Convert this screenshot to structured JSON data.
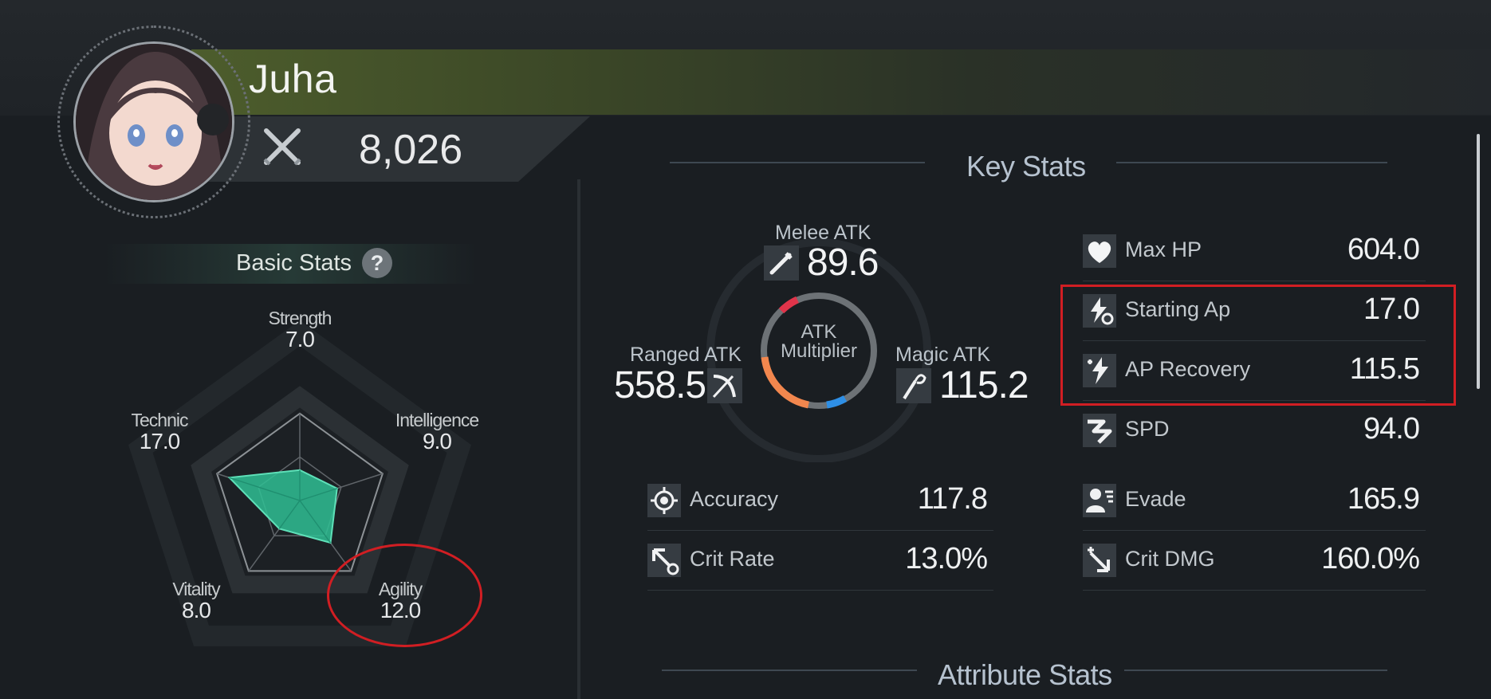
{
  "character": {
    "name": "Juha",
    "power": "8,026",
    "power_icon": "crossed-swords-icon"
  },
  "basic_stats": {
    "title": "Basic Stats",
    "help_icon": "?",
    "radar": [
      {
        "label": "Strength",
        "value": "7.0",
        "level": 7.0
      },
      {
        "label": "Intelligence",
        "value": "9.0",
        "level": 9.0
      },
      {
        "label": "Agility",
        "value": "12.0",
        "level": 12.0
      },
      {
        "label": "Vitality",
        "value": "8.0",
        "level": 8.0
      },
      {
        "label": "Technic",
        "value": "17.0",
        "level": 17.0
      }
    ],
    "radar_max": 20,
    "fill_color": "#2fbf94",
    "highlighted_stat": "Agility"
  },
  "key_stats": {
    "title": "Key Stats",
    "melee": {
      "label": "Melee ATK",
      "value": "89.6"
    },
    "ranged": {
      "label": "Ranged ATK",
      "value": "558.5"
    },
    "magic": {
      "label": "Magic ATK",
      "value": "115.2"
    },
    "multiplier": {
      "line1": "ATK",
      "line2": "Multiplier"
    },
    "left_rows": [
      {
        "icon": "crosshair-icon",
        "label": "Accuracy",
        "value": "117.8"
      },
      {
        "icon": "crit-rate-icon",
        "label": "Crit Rate",
        "value": "13.0%"
      }
    ],
    "right_rows": [
      {
        "icon": "heart-icon",
        "label": "Max HP",
        "value": "604.0"
      },
      {
        "icon": "starting-ap-icon",
        "label": "Starting Ap",
        "value": "17.0"
      },
      {
        "icon": "ap-recovery-icon",
        "label": "AP Recovery",
        "value": "115.5"
      },
      {
        "icon": "speed-icon",
        "label": "SPD",
        "value": "94.0"
      },
      {
        "icon": "evade-icon",
        "label": "Evade",
        "value": "165.9"
      },
      {
        "icon": "crit-dmg-icon",
        "label": "Crit DMG",
        "value": "160.0%"
      }
    ]
  },
  "attribute_stats": {
    "title": "Attribute Stats"
  },
  "colors": {
    "accent_red": "#d11e23",
    "melee_red": "#e0344a",
    "ranged_orange": "#f2874e",
    "magic_blue": "#2e8fe6"
  }
}
